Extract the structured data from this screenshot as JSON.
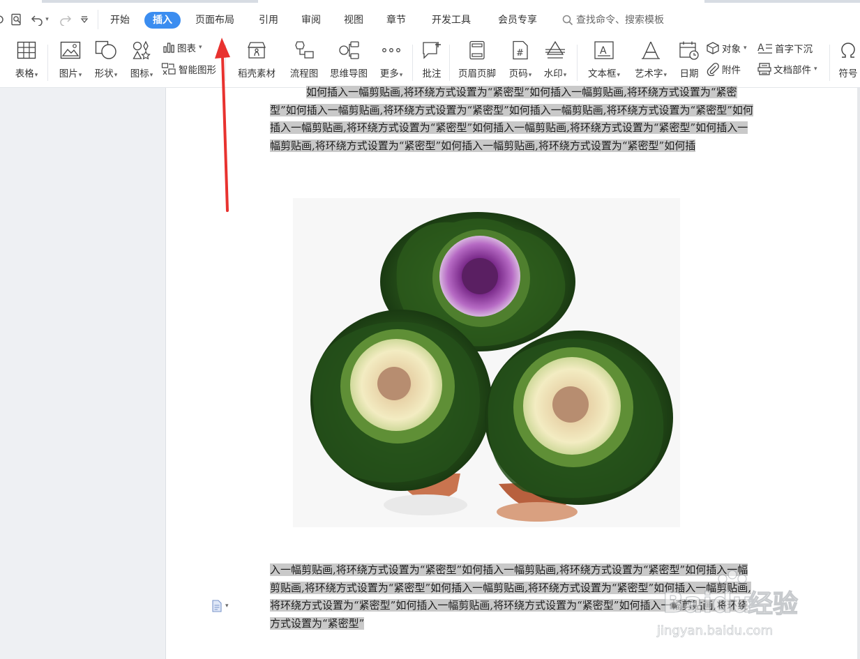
{
  "toolbar": {
    "tabs": [
      "开始",
      "插入",
      "页面布局",
      "引用",
      "审阅",
      "视图",
      "章节",
      "开发工具",
      "会员专享"
    ],
    "active_tab": "插入",
    "search_placeholder": "查找命令、搜索模板"
  },
  "ribbon": {
    "table": "表格",
    "picture": "图片",
    "shape": "形状",
    "icon": "图标",
    "chart": "图表",
    "smart_art": "智能图形",
    "docer": "稻壳素材",
    "flowchart": "流程图",
    "mindmap": "思维导图",
    "more": "更多",
    "comment": "批注",
    "header_footer": "页眉页脚",
    "page_number": "页码",
    "watermark": "水印",
    "textbox": "文本框",
    "wordart": "艺术字",
    "date": "日期",
    "object": "对象",
    "attachment": "附件",
    "dropcap": "首字下沉",
    "doc_parts": "文档部件",
    "symbol": "符号"
  },
  "document": {
    "paragraph_top": "如何插入一幅剪贴画,将环绕方式设置为“紧密型”如何插入一幅剪贴画,将环绕方式设置为“紧密型”如何插入一幅剪贴画,将环绕方式设置为“紧密型”如何插入一幅剪贴画,将环绕方式设置为“紧密型”如何插入一幅剪贴画,将环绕方式设置为“紧密型”如何插入一幅剪贴画,将环绕方式设置为“紧密型”如何插入一幅剪贴画,将环绕方式设置为“紧密型”如何插入一幅剪贴画,将环绕方式设置为“紧密型”如何插",
    "paragraph_bottom": "入一幅剪贴画,将环绕方式设置为“紧密型”如何插入一幅剪贴画,将环绕方式设置为“紧密型”如何插入一幅剪贴画,将环绕方式设置为“紧密型”如何插入一幅剪贴画,将环绕方式设置为“紧密型”如何插入一幅剪贴画,将环绕方式设置为“紧密型”如何插入一幅剪贴画,将环绕方式设置为“紧密型”如何插入一幅剪贴画,将环绕方式设置为“紧密型”",
    "image_description": "ornamental-kale-photo"
  },
  "watermark": {
    "brand": "Baidu",
    "brand_cn": "经验",
    "url": "jingyan.baidu.com"
  },
  "colors": {
    "accent": "#3b8df0",
    "highlight": "#c9c9c9",
    "arrow": "#e8322f"
  }
}
